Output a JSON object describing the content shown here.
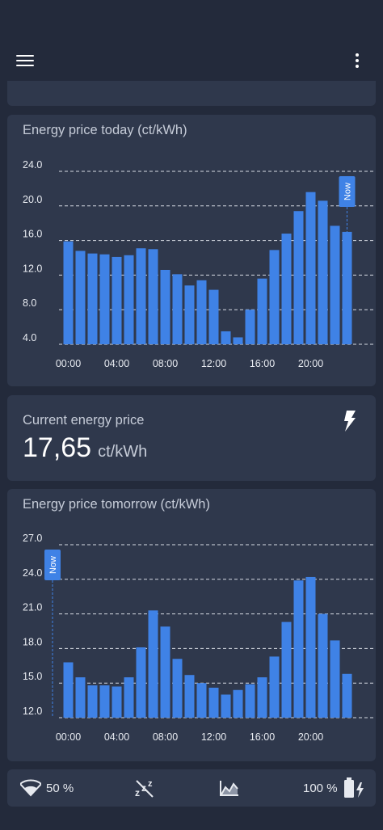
{
  "toolbar": {
    "menu_icon": "menu-icon",
    "more_icon": "more-vert-icon"
  },
  "today_card": {
    "title": "Energy price today (ct/kWh)",
    "now_label": "Now",
    "accent": "#3f82e6",
    "chart_data": {
      "type": "bar",
      "title": "Energy price today (ct/kWh)",
      "x": [
        "00:00",
        "01:00",
        "02:00",
        "03:00",
        "04:00",
        "05:00",
        "06:00",
        "07:00",
        "08:00",
        "09:00",
        "10:00",
        "11:00",
        "12:00",
        "13:00",
        "14:00",
        "15:00",
        "16:00",
        "17:00",
        "18:00",
        "19:00",
        "20:00",
        "21:00",
        "22:00",
        "23:00"
      ],
      "values": [
        15.9,
        14.8,
        14.5,
        14.4,
        14.1,
        14.3,
        15.1,
        15.0,
        12.6,
        12.1,
        10.8,
        11.4,
        10.3,
        5.5,
        4.8,
        8.0,
        11.6,
        14.9,
        16.8,
        19.4,
        21.6,
        20.6,
        17.7,
        17.0
      ],
      "x_tick_labels": [
        "00:00",
        "04:00",
        "08:00",
        "12:00",
        "16:00",
        "20:00"
      ],
      "y_tick_labels": [
        "4.0",
        "8.0",
        "12.0",
        "16.0",
        "20.0",
        "24.0"
      ],
      "ylim": [
        4.0,
        24.0
      ],
      "now_index": 23,
      "grid": "horizontal dashed"
    }
  },
  "current_card": {
    "title": "Current energy price",
    "value": "17,65",
    "unit": "ct/kWh",
    "icon": "flash-icon"
  },
  "tomorrow_card": {
    "title": "Energy price tomorrow (ct/kWh)",
    "now_label": "Now",
    "accent": "#3f82e6",
    "chart_data": {
      "type": "bar",
      "title": "Energy price tomorrow (ct/kWh)",
      "x": [
        "00:00",
        "01:00",
        "02:00",
        "03:00",
        "04:00",
        "05:00",
        "06:00",
        "07:00",
        "08:00",
        "09:00",
        "10:00",
        "11:00",
        "12:00",
        "13:00",
        "14:00",
        "15:00",
        "16:00",
        "17:00",
        "18:00",
        "19:00",
        "20:00",
        "21:00",
        "22:00",
        "23:00"
      ],
      "values": [
        16.8,
        15.5,
        14.8,
        14.8,
        14.7,
        15.5,
        18.1,
        21.3,
        19.9,
        17.1,
        15.7,
        15.0,
        14.6,
        14.0,
        14.4,
        14.9,
        15.5,
        17.3,
        20.3,
        23.9,
        24.2,
        21.0,
        18.7,
        15.8
      ],
      "x_tick_labels": [
        "00:00",
        "04:00",
        "08:00",
        "12:00",
        "16:00",
        "20:00"
      ],
      "y_tick_labels": [
        "12.0",
        "15.0",
        "18.0",
        "21.0",
        "24.0",
        "27.0"
      ],
      "ylim": [
        12.0,
        27.0
      ],
      "now_index": 0,
      "grid": "horizontal dashed"
    }
  },
  "status_bar": {
    "wifi": {
      "icon": "wifi-icon",
      "text": "50 %"
    },
    "sleep": {
      "icon": "sleep-off-icon"
    },
    "chart": {
      "icon": "area-chart-icon"
    },
    "battery": {
      "icon": "battery-charging-icon",
      "text": "100 %"
    }
  }
}
